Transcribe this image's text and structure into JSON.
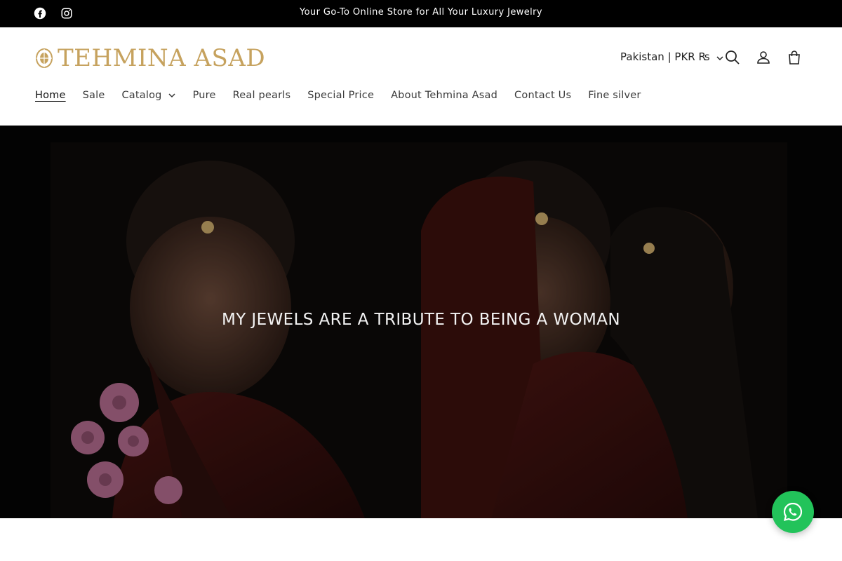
{
  "announcement": {
    "message": "Your Go-To Online Store for All Your Luxury Jewelry",
    "social": [
      "facebook-icon",
      "instagram-icon"
    ]
  },
  "header": {
    "logo_text": "TEHMINA ASAD",
    "locale": "Pakistan | PKR ₨",
    "icons": [
      "search-icon",
      "account-icon",
      "cart-icon"
    ]
  },
  "nav": {
    "items": [
      {
        "label": "Home",
        "active": true
      },
      {
        "label": "Sale"
      },
      {
        "label": "Catalog",
        "has_dropdown": true
      },
      {
        "label": "Pure"
      },
      {
        "label": "Real pearls"
      },
      {
        "label": "Special Price"
      },
      {
        "label": "About Tehmina Asad"
      },
      {
        "label": "Contact Us"
      },
      {
        "label": "Fine silver"
      }
    ]
  },
  "hero": {
    "heading": "MY JEWELS ARE A TRIBUTE TO BEING A WOMAN"
  },
  "colors": {
    "brand_gold": "#c6a25e",
    "announcement_bg": "#000000",
    "whatsapp_green": "#22c35a"
  },
  "floating": {
    "icon": "whatsapp-icon"
  }
}
